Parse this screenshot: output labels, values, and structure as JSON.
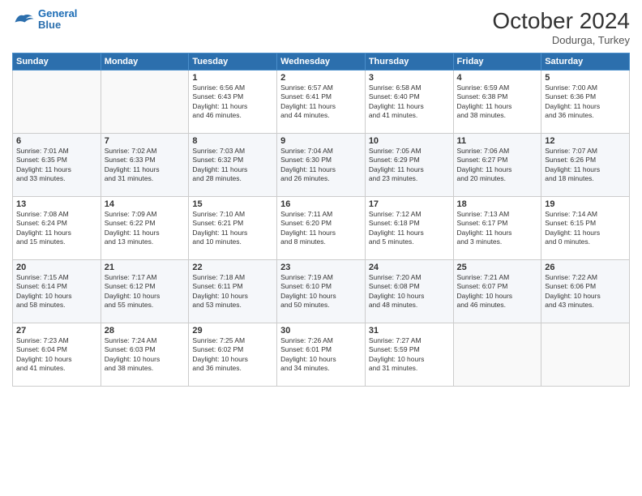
{
  "logo": {
    "line1": "General",
    "line2": "Blue"
  },
  "title": "October 2024",
  "subtitle": "Dodurga, Turkey",
  "days_header": [
    "Sunday",
    "Monday",
    "Tuesday",
    "Wednesday",
    "Thursday",
    "Friday",
    "Saturday"
  ],
  "weeks": [
    [
      {
        "num": "",
        "detail": ""
      },
      {
        "num": "",
        "detail": ""
      },
      {
        "num": "1",
        "detail": "Sunrise: 6:56 AM\nSunset: 6:43 PM\nDaylight: 11 hours\nand 46 minutes."
      },
      {
        "num": "2",
        "detail": "Sunrise: 6:57 AM\nSunset: 6:41 PM\nDaylight: 11 hours\nand 44 minutes."
      },
      {
        "num": "3",
        "detail": "Sunrise: 6:58 AM\nSunset: 6:40 PM\nDaylight: 11 hours\nand 41 minutes."
      },
      {
        "num": "4",
        "detail": "Sunrise: 6:59 AM\nSunset: 6:38 PM\nDaylight: 11 hours\nand 38 minutes."
      },
      {
        "num": "5",
        "detail": "Sunrise: 7:00 AM\nSunset: 6:36 PM\nDaylight: 11 hours\nand 36 minutes."
      }
    ],
    [
      {
        "num": "6",
        "detail": "Sunrise: 7:01 AM\nSunset: 6:35 PM\nDaylight: 11 hours\nand 33 minutes."
      },
      {
        "num": "7",
        "detail": "Sunrise: 7:02 AM\nSunset: 6:33 PM\nDaylight: 11 hours\nand 31 minutes."
      },
      {
        "num": "8",
        "detail": "Sunrise: 7:03 AM\nSunset: 6:32 PM\nDaylight: 11 hours\nand 28 minutes."
      },
      {
        "num": "9",
        "detail": "Sunrise: 7:04 AM\nSunset: 6:30 PM\nDaylight: 11 hours\nand 26 minutes."
      },
      {
        "num": "10",
        "detail": "Sunrise: 7:05 AM\nSunset: 6:29 PM\nDaylight: 11 hours\nand 23 minutes."
      },
      {
        "num": "11",
        "detail": "Sunrise: 7:06 AM\nSunset: 6:27 PM\nDaylight: 11 hours\nand 20 minutes."
      },
      {
        "num": "12",
        "detail": "Sunrise: 7:07 AM\nSunset: 6:26 PM\nDaylight: 11 hours\nand 18 minutes."
      }
    ],
    [
      {
        "num": "13",
        "detail": "Sunrise: 7:08 AM\nSunset: 6:24 PM\nDaylight: 11 hours\nand 15 minutes."
      },
      {
        "num": "14",
        "detail": "Sunrise: 7:09 AM\nSunset: 6:22 PM\nDaylight: 11 hours\nand 13 minutes."
      },
      {
        "num": "15",
        "detail": "Sunrise: 7:10 AM\nSunset: 6:21 PM\nDaylight: 11 hours\nand 10 minutes."
      },
      {
        "num": "16",
        "detail": "Sunrise: 7:11 AM\nSunset: 6:20 PM\nDaylight: 11 hours\nand 8 minutes."
      },
      {
        "num": "17",
        "detail": "Sunrise: 7:12 AM\nSunset: 6:18 PM\nDaylight: 11 hours\nand 5 minutes."
      },
      {
        "num": "18",
        "detail": "Sunrise: 7:13 AM\nSunset: 6:17 PM\nDaylight: 11 hours\nand 3 minutes."
      },
      {
        "num": "19",
        "detail": "Sunrise: 7:14 AM\nSunset: 6:15 PM\nDaylight: 11 hours\nand 0 minutes."
      }
    ],
    [
      {
        "num": "20",
        "detail": "Sunrise: 7:15 AM\nSunset: 6:14 PM\nDaylight: 10 hours\nand 58 minutes."
      },
      {
        "num": "21",
        "detail": "Sunrise: 7:17 AM\nSunset: 6:12 PM\nDaylight: 10 hours\nand 55 minutes."
      },
      {
        "num": "22",
        "detail": "Sunrise: 7:18 AM\nSunset: 6:11 PM\nDaylight: 10 hours\nand 53 minutes."
      },
      {
        "num": "23",
        "detail": "Sunrise: 7:19 AM\nSunset: 6:10 PM\nDaylight: 10 hours\nand 50 minutes."
      },
      {
        "num": "24",
        "detail": "Sunrise: 7:20 AM\nSunset: 6:08 PM\nDaylight: 10 hours\nand 48 minutes."
      },
      {
        "num": "25",
        "detail": "Sunrise: 7:21 AM\nSunset: 6:07 PM\nDaylight: 10 hours\nand 46 minutes."
      },
      {
        "num": "26",
        "detail": "Sunrise: 7:22 AM\nSunset: 6:06 PM\nDaylight: 10 hours\nand 43 minutes."
      }
    ],
    [
      {
        "num": "27",
        "detail": "Sunrise: 7:23 AM\nSunset: 6:04 PM\nDaylight: 10 hours\nand 41 minutes."
      },
      {
        "num": "28",
        "detail": "Sunrise: 7:24 AM\nSunset: 6:03 PM\nDaylight: 10 hours\nand 38 minutes."
      },
      {
        "num": "29",
        "detail": "Sunrise: 7:25 AM\nSunset: 6:02 PM\nDaylight: 10 hours\nand 36 minutes."
      },
      {
        "num": "30",
        "detail": "Sunrise: 7:26 AM\nSunset: 6:01 PM\nDaylight: 10 hours\nand 34 minutes."
      },
      {
        "num": "31",
        "detail": "Sunrise: 7:27 AM\nSunset: 5:59 PM\nDaylight: 10 hours\nand 31 minutes."
      },
      {
        "num": "",
        "detail": ""
      },
      {
        "num": "",
        "detail": ""
      }
    ]
  ]
}
